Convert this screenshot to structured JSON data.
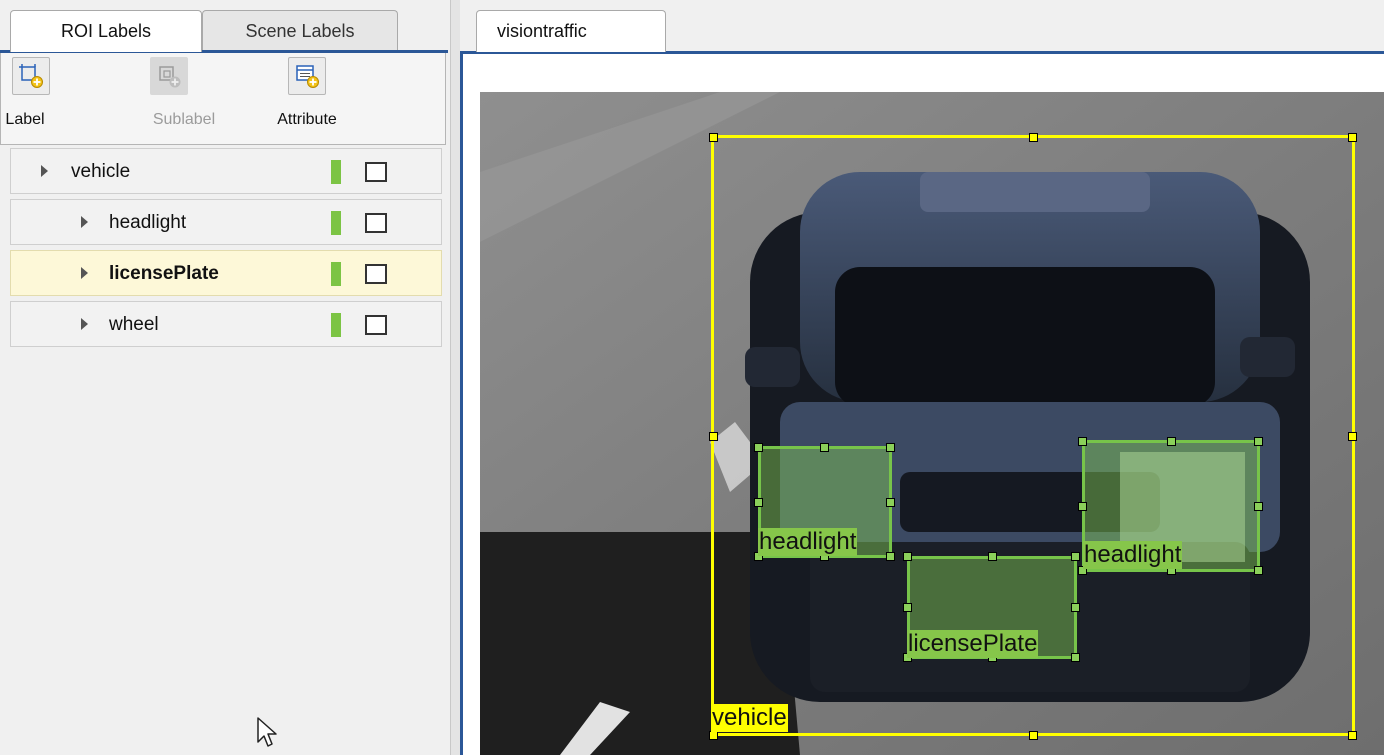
{
  "left_panel": {
    "tabs": [
      {
        "label": "ROI Labels",
        "active": true
      },
      {
        "label": "Scene Labels",
        "active": false
      }
    ],
    "toolbar": {
      "label_button": "Label",
      "sublabel_button": "Sublabel",
      "attribute_button": "Attribute"
    },
    "labels": [
      {
        "name": "vehicle",
        "color": "#7cc444",
        "level": 0,
        "selected": false
      },
      {
        "name": "headlight",
        "color": "#7cc444",
        "level": 1,
        "selected": false
      },
      {
        "name": "licensePlate",
        "color": "#7cc444",
        "level": 1,
        "selected": true
      },
      {
        "name": "wheel",
        "color": "#7cc444",
        "level": 1,
        "selected": false
      }
    ]
  },
  "display": {
    "tab_title": "visiontraffic",
    "annotations": [
      {
        "label": "vehicle",
        "color": "#ffff00"
      },
      {
        "label": "headlight",
        "color": "#86c64a"
      },
      {
        "label": "headlight",
        "color": "#86c64a"
      },
      {
        "label": "licensePlate",
        "color": "#86c64a"
      }
    ]
  },
  "icons": {
    "label": "add-roi-label-icon",
    "sublabel": "add-sublabel-icon",
    "attribute": "add-attribute-icon",
    "cursor": "mouse-pointer-icon"
  }
}
